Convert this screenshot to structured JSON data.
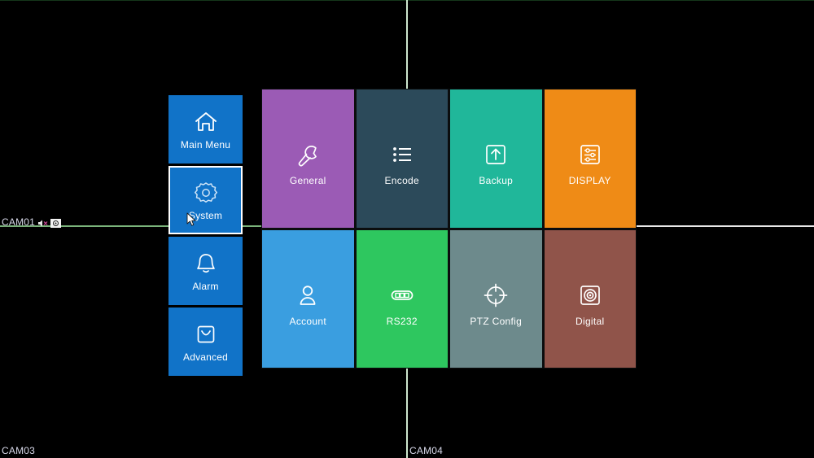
{
  "live_view": {
    "channels": [
      {
        "id": "cam01",
        "label": "CAM01",
        "icons": [
          "mute-icon",
          "record-icon"
        ]
      },
      {
        "id": "cam03",
        "label": "CAM03",
        "icons": []
      },
      {
        "id": "cam04",
        "label": "CAM04",
        "icons": []
      }
    ]
  },
  "sidebar": {
    "items": [
      {
        "label": "Main Menu",
        "icon": "home-icon",
        "selected": false,
        "color": "#1173c8"
      },
      {
        "label": "System",
        "icon": "gear-icon",
        "selected": true,
        "color": "#1173c8"
      },
      {
        "label": "Alarm",
        "icon": "bell-icon",
        "selected": false,
        "color": "#1173c8"
      },
      {
        "label": "Advanced",
        "icon": "toolbox-icon",
        "selected": false,
        "color": "#1173c8"
      }
    ]
  },
  "tiles": [
    {
      "label": "General",
      "icon": "wrench-icon",
      "color": "#9b5bb5"
    },
    {
      "label": "Encode",
      "icon": "list-icon",
      "color": "#2c4a5a"
    },
    {
      "label": "Backup",
      "icon": "upload-box-icon",
      "color": "#20b79a"
    },
    {
      "label": "DISPLAY",
      "icon": "sliders-icon",
      "color": "#ef8b16"
    },
    {
      "label": "Account",
      "icon": "person-icon",
      "color": "#3a9ee0"
    },
    {
      "label": "RS232",
      "icon": "connector-icon",
      "color": "#2ec75f"
    },
    {
      "label": "PTZ Config",
      "icon": "crosshair-icon",
      "color": "#6d8a8c"
    },
    {
      "label": "Digital",
      "icon": "lens-icon",
      "color": "#90544a"
    }
  ],
  "colors": {
    "sidebar_blue": "#1173c8",
    "selection_border": "#ffffff",
    "divider_green": "#7bb47b",
    "divider_white": "#e8e8e8",
    "background": "#000000"
  }
}
